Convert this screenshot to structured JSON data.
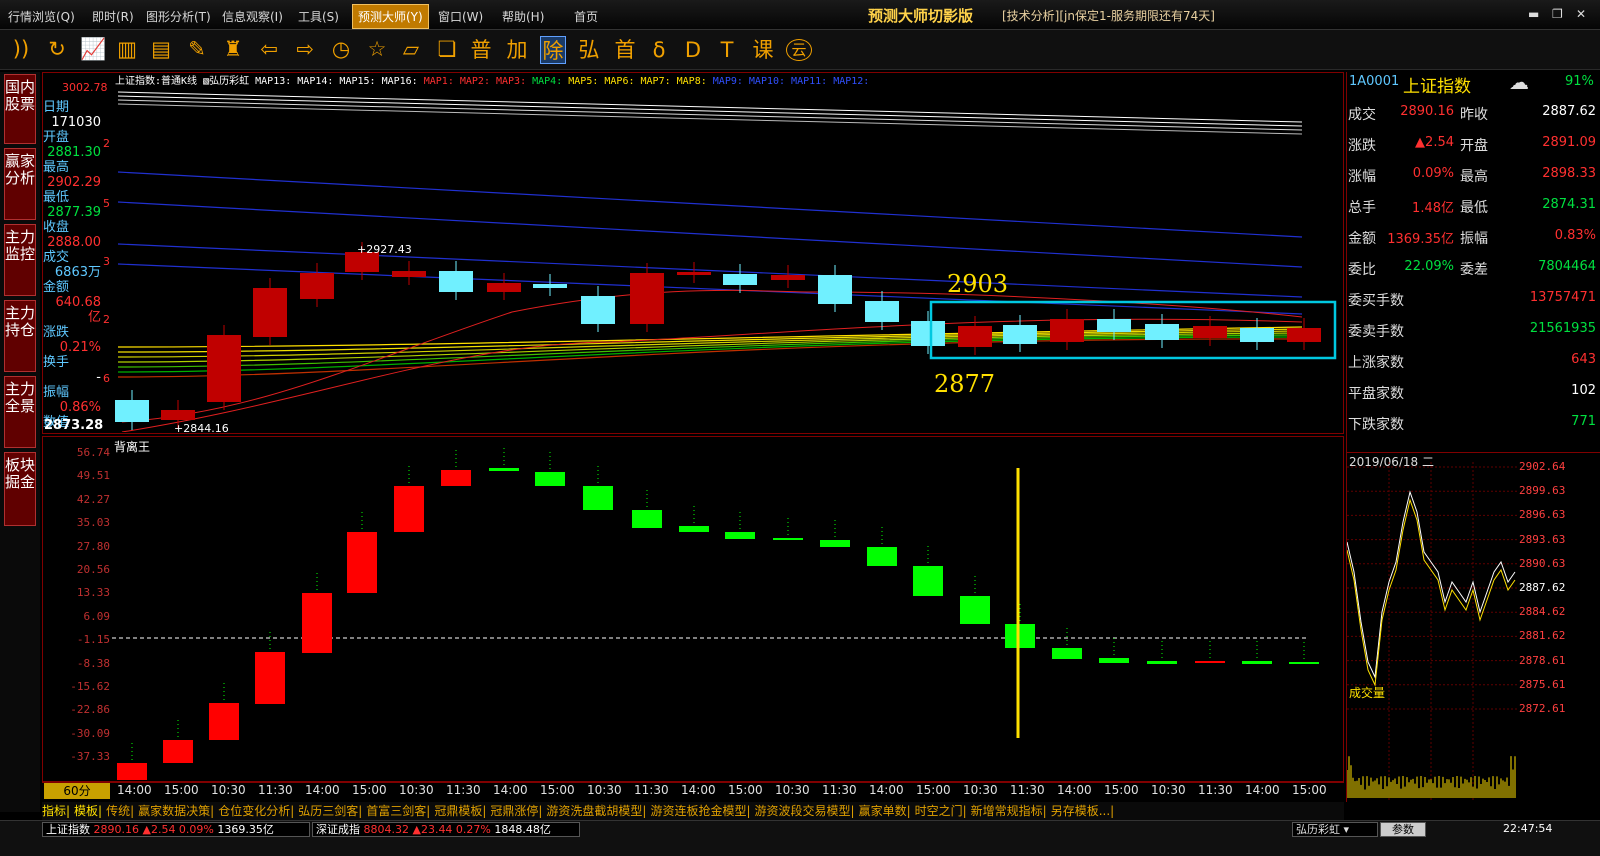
{
  "menu": {
    "items": [
      "行情浏览(Q)",
      "即时(R)",
      "图形分析(T)",
      "信息观察(I)",
      "工具(S)",
      "预测大师(Y)",
      "窗口(W)",
      "帮助(H)",
      "首页"
    ],
    "active_index": 5
  },
  "app": {
    "title": "预测大师切影版",
    "subtitle": "[技术分析][jn保定1-服务期限还有74天]"
  },
  "toolbar": {
    "icons": [
      "rss-icon",
      "refresh-icon",
      "line-chart-icon",
      "bar-chart-icon",
      "notepad-icon",
      "pencil-icon",
      "tower-icon",
      "arrow-left-icon",
      "arrow-right-icon",
      "clock-icon",
      "star-doc-icon",
      "folder-icon",
      "copy-icon"
    ],
    "chars": [
      "普",
      "加",
      "除",
      "弘",
      "首",
      "δ",
      "D",
      "T",
      "课",
      "云"
    ],
    "selected_char": "除"
  },
  "leftnav": {
    "tabs": [
      "国内股票",
      "赢家分析",
      "主力监控",
      "主力持仓",
      "主力全景",
      "板块掘金"
    ]
  },
  "kline": {
    "header": {
      "title": "上证指数:普通K线",
      "rainbow": "弘历彩虹",
      "maps_white": "MAP13: MAP14: MAP15: MAP16:",
      "maps_red": "MAP1: MAP2: MAP3:",
      "maps_green": "MAP4:",
      "maps_yellow": "MAP5: MAP6: MAP7: MAP8:",
      "maps_blue": "MAP9: MAP10: MAP11: MAP12:"
    },
    "top_price": "3002.78",
    "bottom_price": "2873.28",
    "y_ticks": [
      "2",
      "5",
      "3",
      "2",
      "6"
    ],
    "info": [
      {
        "label": "日期",
        "value": "171030",
        "color": "#ffffff"
      },
      {
        "label": "开盘",
        "value": "2881.30",
        "color": "#00e040"
      },
      {
        "label": "最高",
        "value": "2902.29",
        "color": "#ff3030"
      },
      {
        "label": "最低",
        "value": "2877.39",
        "color": "#00e040"
      },
      {
        "label": "收盘",
        "value": "2888.00",
        "color": "#ff3030"
      },
      {
        "label": "成交",
        "value": "6863万",
        "color": "#5fc8ff"
      },
      {
        "label": "金额",
        "value": "640.68亿",
        "color": "#ff3030"
      },
      {
        "label": "涨跌",
        "value": "0.21%",
        "color": "#ff3030"
      },
      {
        "label": "换手",
        "value": "-",
        "color": "#ffffff"
      },
      {
        "label": "振幅",
        "value": "0.86%",
        "color": "#ff3030"
      },
      {
        "label": "数值",
        "value": "",
        "color": "#ffffff"
      }
    ],
    "annotations": {
      "high_mark": "+2927.43",
      "low_mark": "+2844.16",
      "box_top": "2903",
      "box_bottom": "2877"
    }
  },
  "indicator": {
    "title": "背离王",
    "y_labels": [
      "56.74",
      "49.51",
      "42.27",
      "35.03",
      "27.80",
      "20.56",
      "13.33",
      "6.09",
      "-1.15",
      "-8.38",
      "-15.62",
      "-22.86",
      "-30.09",
      "-37.33"
    ]
  },
  "timeaxis": {
    "period": "60分",
    "labels": [
      "14:00",
      "15:00",
      "10:30",
      "11:30",
      "14:00",
      "15:00",
      "10:30",
      "11:30",
      "14:00",
      "15:00",
      "10:30",
      "11:30",
      "14:00",
      "15:00",
      "10:30",
      "11:30",
      "14:00",
      "15:00",
      "10:30",
      "11:30",
      "14:00",
      "15:00",
      "10:30",
      "11:30",
      "14:00",
      "15:00"
    ]
  },
  "tabs": [
    "指标",
    "模板",
    "传统",
    "赢家数据决策",
    "仓位变化分析",
    "弘历三剑客",
    "首富三剑客",
    "冠鼎模板",
    "冠鼎涨停",
    "游资洗盘截胡模型",
    "游资连板抢金模型",
    "游资波段交易模型",
    "赢家单数",
    "时空之门",
    "新增常规指标",
    "另存模板..."
  ],
  "statusbar": {
    "idx1_name": "上证指数",
    "idx1_vals": "2890.16 ▲2.54 0.09%",
    "idx1_amt": "1369.35亿",
    "idx2_name": "深证成指",
    "idx2_vals": "8804.32 ▲23.44 0.27%",
    "idx2_amt": "1848.48亿",
    "rainbow_btn": "弘历彩虹",
    "param_btn": "参数",
    "time": "22:47:54"
  },
  "quote": {
    "code": "1A0001",
    "name": "上证指数",
    "percent": "91%",
    "rows_pair": [
      {
        "l1": "成交",
        "v1": "2890.16",
        "c1": "#ff3030",
        "l2": "昨收",
        "v2": "2887.62",
        "c2": "#ffffff"
      },
      {
        "l1": "涨跌",
        "v1": "▲2.54",
        "c1": "#ff3030",
        "l2": "开盘",
        "v2": "2891.09",
        "c2": "#ff3030"
      },
      {
        "l1": "涨幅",
        "v1": "0.09%",
        "c1": "#ff3030",
        "l2": "最高",
        "v2": "2898.33",
        "c2": "#ff3030"
      },
      {
        "l1": "总手",
        "v1": "1.48亿",
        "c1": "#ff3030",
        "l2": "最低",
        "v2": "2874.31",
        "c2": "#00e040"
      },
      {
        "l1": "金额",
        "v1": "1369.35亿",
        "c1": "#ff3030",
        "l2": "振幅",
        "v2": "0.83%",
        "c2": "#ff3030"
      },
      {
        "l1": "委比",
        "v1": "22.09%",
        "c1": "#00e040",
        "l2": "委差",
        "v2": "7804464",
        "c2": "#00e040"
      }
    ],
    "rows_single": [
      {
        "label": "委买手数",
        "value": "13757471",
        "color": "#ff3030"
      },
      {
        "label": "委卖手数",
        "value": "21561935",
        "color": "#00e040"
      },
      {
        "label": "上涨家数",
        "value": "643",
        "color": "#ff3030"
      },
      {
        "label": "平盘家数",
        "value": "102",
        "color": "#ffffff"
      },
      {
        "label": "下跌家数",
        "value": "771",
        "color": "#00e040"
      }
    ]
  },
  "minichart": {
    "date": "2019/06/18  二",
    "y_labels": [
      "2902.64",
      "2899.63",
      "2896.63",
      "2893.63",
      "2890.63",
      "2887.62",
      "2884.62",
      "2881.62",
      "2878.61",
      "2875.61",
      "2872.61"
    ],
    "volume_label": "成交量"
  }
}
